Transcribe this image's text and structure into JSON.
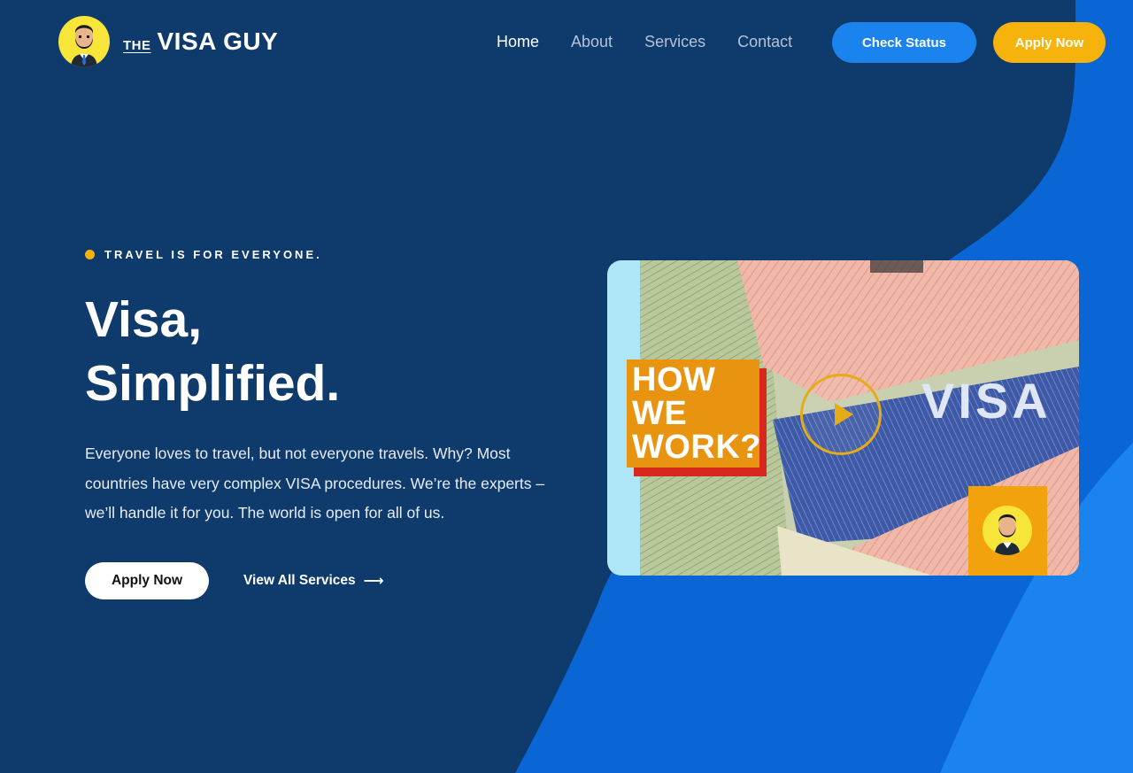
{
  "brand": {
    "prefix": "THE",
    "name": "VISA GUY"
  },
  "nav": [
    {
      "label": "Home",
      "active": true
    },
    {
      "label": "About",
      "active": false
    },
    {
      "label": "Services",
      "active": false
    },
    {
      "label": "Contact",
      "active": false
    }
  ],
  "header_buttons": {
    "check_status": "Check Status",
    "apply_now": "Apply Now"
  },
  "hero": {
    "tagline": "TRAVEL IS FOR EVERYONE.",
    "headline_line1": "Visa,",
    "headline_line2": "Simplified.",
    "description": "Everyone loves to travel, but not everyone travels. Why? Most countries have very complex VISA procedures. We’re the experts – we’ll handle it for you. The world is open for all of us.",
    "primary_cta": "Apply Now",
    "secondary_cta": "View All Services",
    "secondary_cta_icon": "arrow-right-icon"
  },
  "video": {
    "title_line1": "HOW",
    "title_line2": "WE",
    "title_line3": "WORK?",
    "image_text": "VISA",
    "play_icon": "play-icon"
  },
  "colors": {
    "background_navy": "#0e3a6c",
    "accent_blue": "#1a83ee",
    "accent_yellow": "#f5b30c",
    "avatar_yellow": "#f7e53a"
  }
}
